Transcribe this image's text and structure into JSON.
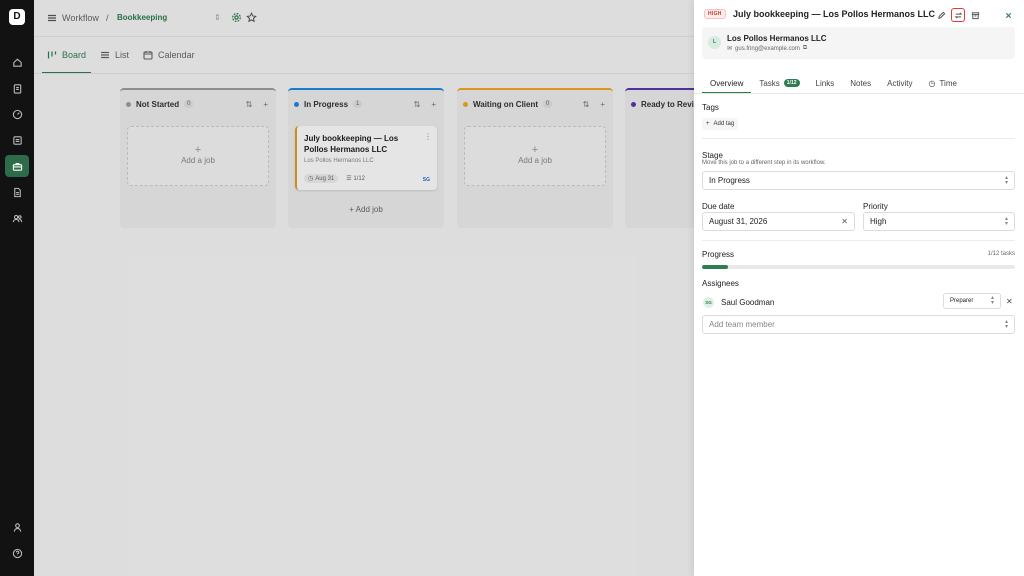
{
  "app": {
    "logo": "D"
  },
  "rail": {
    "icons": [
      "home-icon",
      "clipboard-icon",
      "gauge-icon",
      "list-icon",
      "briefcase-icon",
      "document-icon",
      "users-icon",
      "user-icon",
      "help-icon"
    ],
    "active": "briefcase-icon"
  },
  "breadcrumb": {
    "root": "Workflow",
    "separator": "/",
    "current": "Bookkeeping"
  },
  "view_tabs": [
    {
      "label": "Board",
      "active": true
    },
    {
      "label": "List",
      "active": false
    },
    {
      "label": "Calendar",
      "active": false
    }
  ],
  "columns": [
    {
      "name": "Not Started",
      "count": "0",
      "color": "#9e9e9e",
      "add_label": "Add a job"
    },
    {
      "name": "In Progress",
      "count": "1",
      "color": "#1e88e5",
      "add_label": "Add job"
    },
    {
      "name": "Waiting on Client",
      "count": "0",
      "color": "#f5a623",
      "add_label": "Add a job"
    },
    {
      "name": "Ready to Revi",
      "count": "",
      "color": "#5e35b1",
      "add_label": ""
    }
  ],
  "card": {
    "title": "July bookkeeping — Los Pollos Hermanos LLC",
    "client": "Los Pollos Hermanos LLC",
    "due": "Aug 31",
    "tasks": "1/12",
    "assignee_initials": "SG"
  },
  "panel": {
    "priority_badge": "HIGH",
    "title": "July bookkeeping — Los Pollos Hermanos LLC",
    "client": {
      "initial": "L",
      "name": "Los Pollos Hermanos LLC",
      "email": "gus.fring@example.com"
    },
    "tabs": [
      {
        "label": "Overview",
        "active": true
      },
      {
        "label": "Tasks",
        "count": "1/12"
      },
      {
        "label": "Links"
      },
      {
        "label": "Notes"
      },
      {
        "label": "Activity"
      },
      {
        "label": "Time"
      }
    ],
    "tags": {
      "label": "Tags",
      "add_label": "Add tag"
    },
    "stage": {
      "label": "Stage",
      "help": "Move this job to a different step in its workflow.",
      "value": "In Progress"
    },
    "due_date": {
      "label": "Due date",
      "value": "August 31, 2026"
    },
    "priority": {
      "label": "Priority",
      "value": "High"
    },
    "progress": {
      "label": "Progress",
      "text": "1/12 tasks",
      "fraction": 0.0833
    },
    "assignees": {
      "label": "Assignees",
      "items": [
        {
          "initials": "SG",
          "name": "Saul Goodman",
          "role": "Preparer"
        }
      ],
      "add_placeholder": "Add team member"
    }
  },
  "colors": {
    "accent": "#2e7d52",
    "high": "#c0392b",
    "card_border": "#e59b2b"
  }
}
